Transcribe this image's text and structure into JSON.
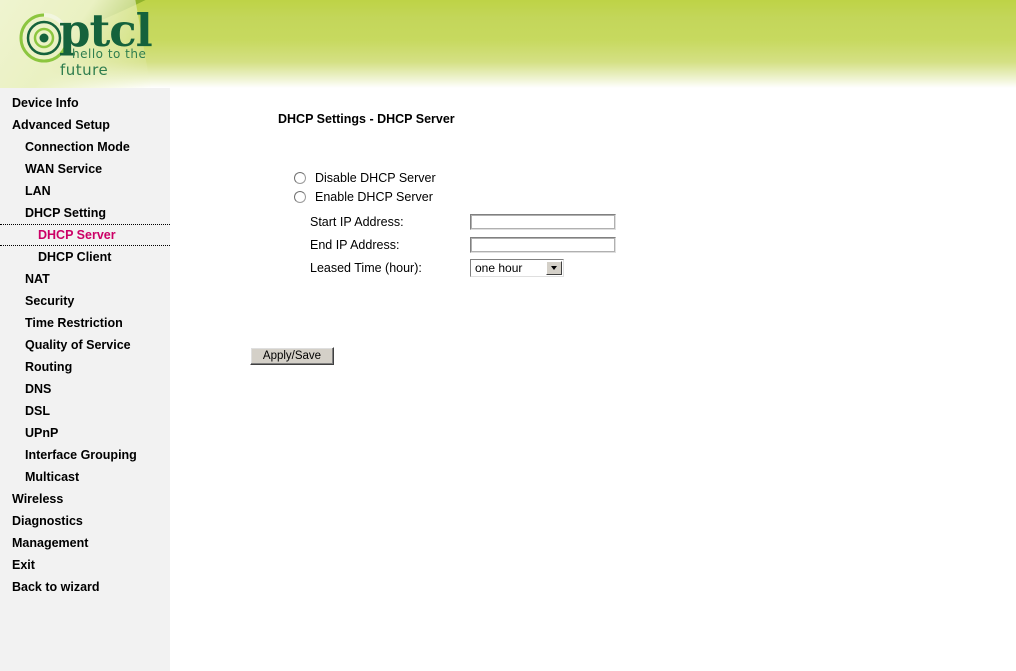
{
  "branding": {
    "logo_word": "ptcl",
    "tagline_line1": "hello to the",
    "tagline_line2": "future",
    "accent_green": "#15623c",
    "banner_green": "#bed346"
  },
  "sidebar": {
    "items": [
      {
        "label": "Device Info",
        "level": 1,
        "selected": false
      },
      {
        "label": "Advanced Setup",
        "level": 1,
        "selected": false
      },
      {
        "label": "Connection Mode",
        "level": 2,
        "selected": false
      },
      {
        "label": "WAN Service",
        "level": 2,
        "selected": false
      },
      {
        "label": "LAN",
        "level": 2,
        "selected": false
      },
      {
        "label": "DHCP Setting",
        "level": 2,
        "selected": false
      },
      {
        "label": "DHCP Server",
        "level": 3,
        "selected": true
      },
      {
        "label": "DHCP Client",
        "level": 3,
        "selected": false
      },
      {
        "label": "NAT",
        "level": 2,
        "selected": false
      },
      {
        "label": "Security",
        "level": 2,
        "selected": false
      },
      {
        "label": "Time Restriction",
        "level": 2,
        "selected": false
      },
      {
        "label": "Quality of Service",
        "level": 2,
        "selected": false
      },
      {
        "label": "Routing",
        "level": 2,
        "selected": false
      },
      {
        "label": "DNS",
        "level": 2,
        "selected": false
      },
      {
        "label": "DSL",
        "level": 2,
        "selected": false
      },
      {
        "label": "UPnP",
        "level": 2,
        "selected": false
      },
      {
        "label": "Interface Grouping",
        "level": 2,
        "selected": false
      },
      {
        "label": "Multicast",
        "level": 2,
        "selected": false
      },
      {
        "label": "Wireless",
        "level": 1,
        "selected": false
      },
      {
        "label": "Diagnostics",
        "level": 1,
        "selected": false
      },
      {
        "label": "Management",
        "level": 1,
        "selected": false
      },
      {
        "label": "Exit",
        "level": 1,
        "selected": false
      },
      {
        "label": "Back to wizard",
        "level": 1,
        "selected": false
      }
    ],
    "selected_color": "#cc0066"
  },
  "main": {
    "page_title": "DHCP Settings - DHCP Server",
    "radios": [
      {
        "label": "Disable DHCP Server",
        "checked": false
      },
      {
        "label": "Enable DHCP Server",
        "checked": false
      }
    ],
    "fields": [
      {
        "label": "Start IP Address:",
        "value": "",
        "placeholder": ""
      },
      {
        "label": "End IP Address:",
        "value": "",
        "placeholder": ""
      }
    ],
    "leased_time": {
      "label": "Leased Time (hour):",
      "selected": "one hour",
      "options": [
        "one hour"
      ]
    },
    "apply_button": "Apply/Save"
  }
}
